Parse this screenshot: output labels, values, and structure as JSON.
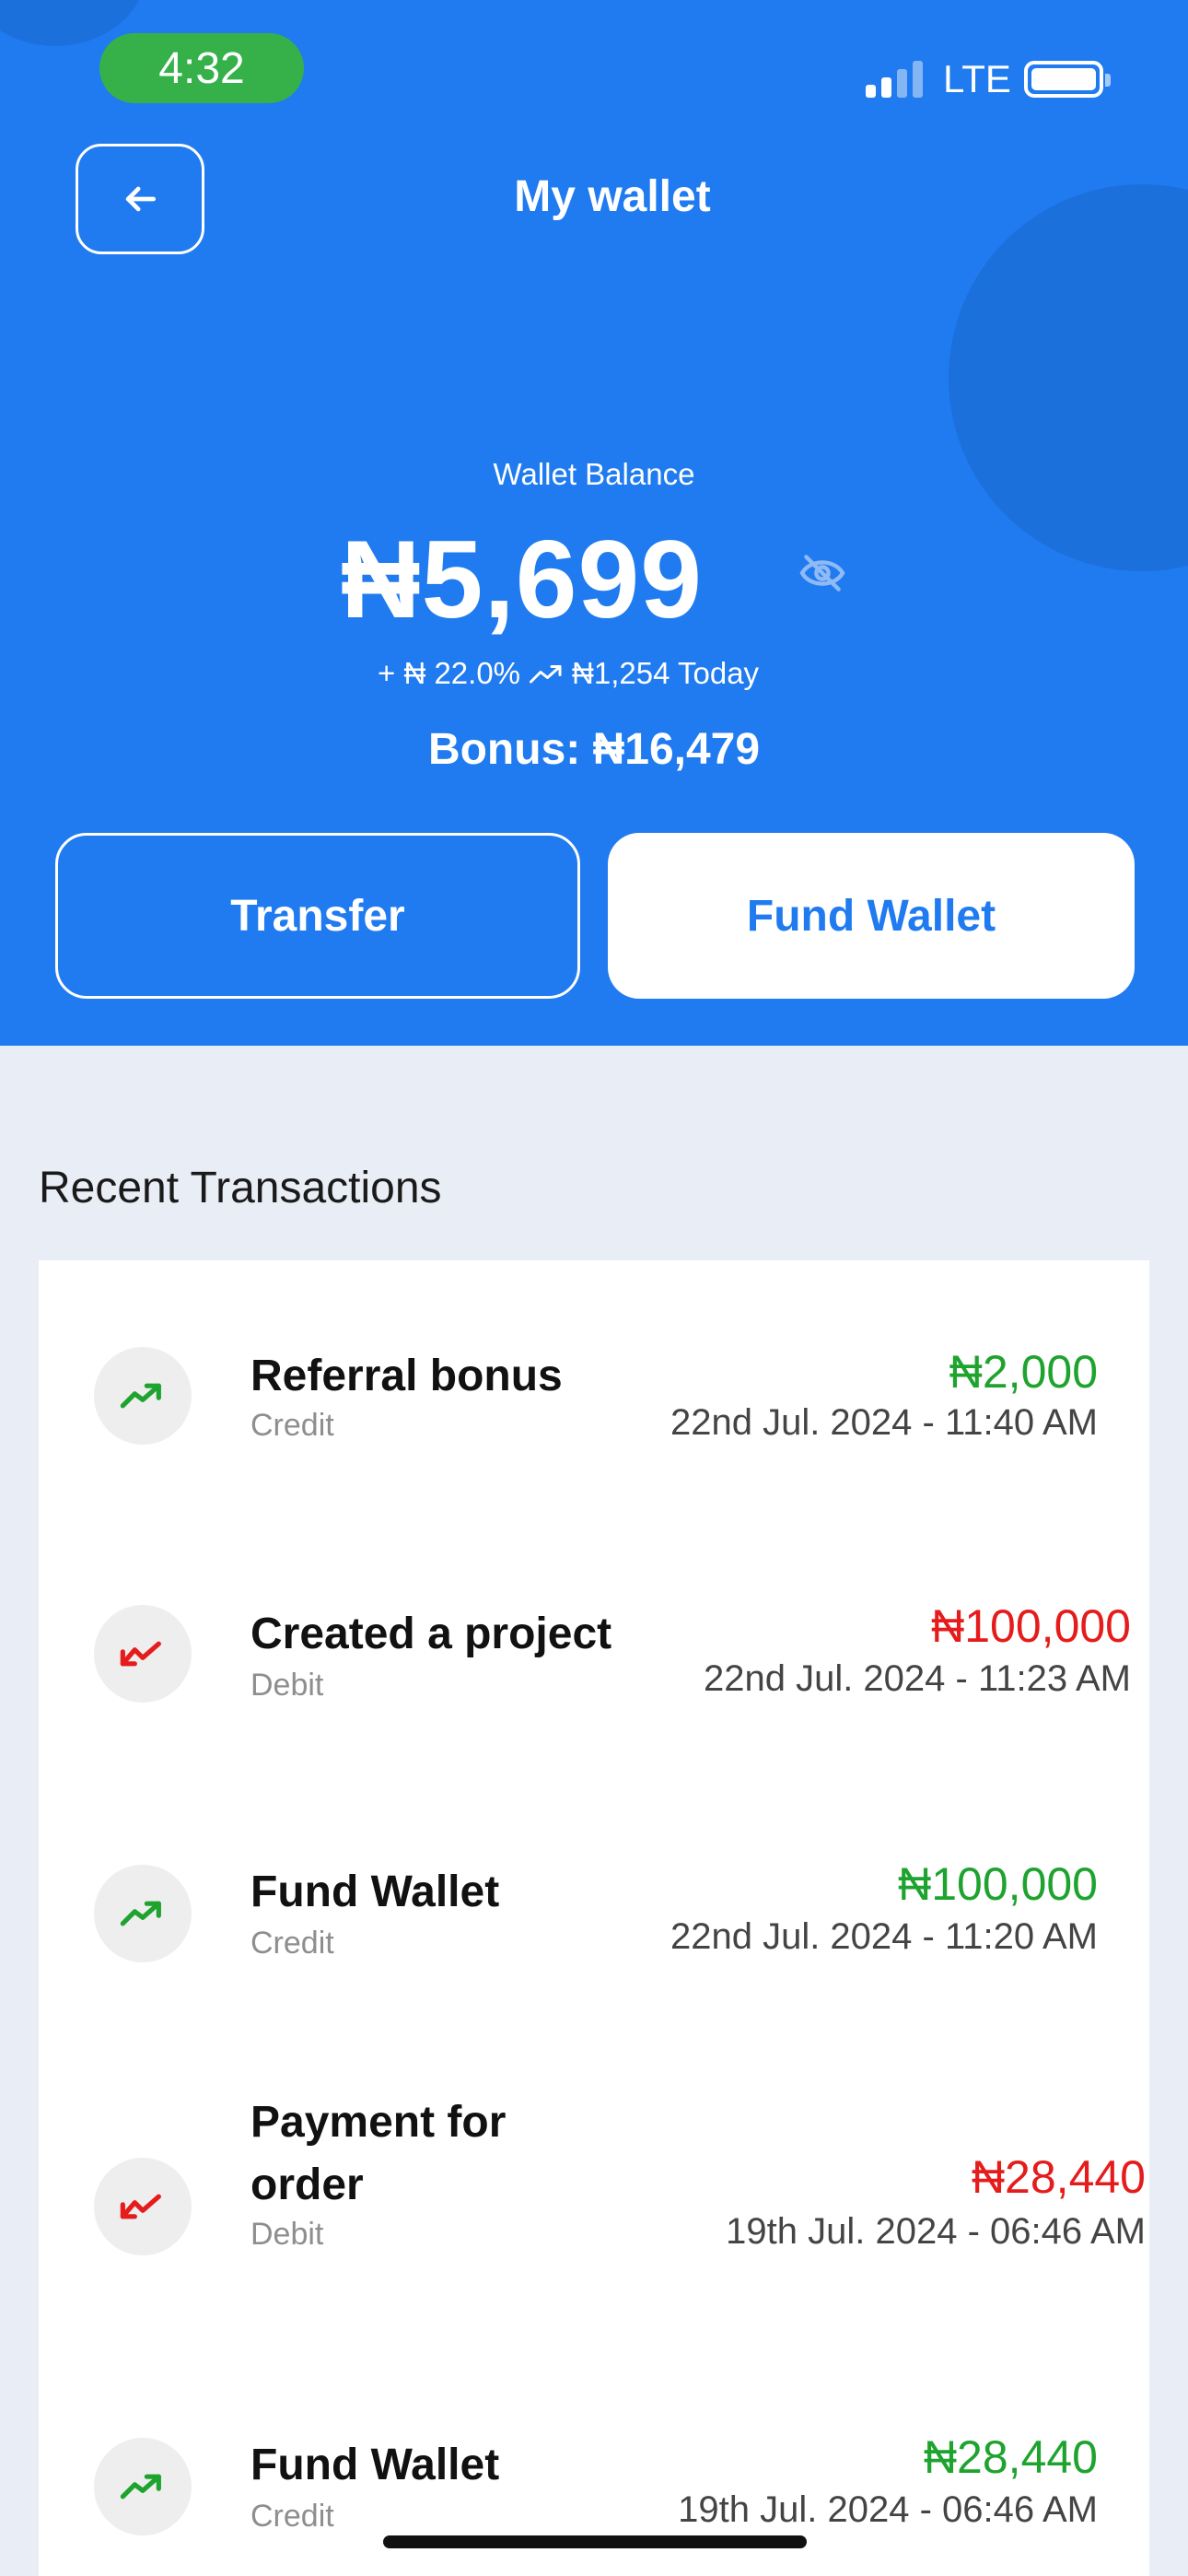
{
  "status_bar": {
    "time": "4:32",
    "network": "LTE"
  },
  "header": {
    "title": "My wallet"
  },
  "wallet": {
    "balance_label": "Wallet Balance",
    "balance": "₦5,699",
    "change_percent": "+ ₦ 22.0%",
    "change_today": "₦1,254 Today",
    "bonus": "Bonus: ₦16,479"
  },
  "actions": {
    "transfer_label": "Transfer",
    "fund_label": "Fund Wallet"
  },
  "transactions_title": "Recent Transactions",
  "transactions": [
    {
      "title": "Referral bonus",
      "type": "Credit",
      "amount": "₦2,000",
      "date": "22nd Jul. 2024 - 11:40 AM"
    },
    {
      "title": "Created a project",
      "type": "Debit",
      "amount": "₦100,000",
      "date": "22nd Jul. 2024 - 11:23 AM"
    },
    {
      "title": "Fund Wallet",
      "type": "Credit",
      "amount": "₦100,000",
      "date": "22nd Jul. 2024 - 11:20 AM"
    },
    {
      "title": "Payment for order",
      "type": "Debit",
      "amount": "₦28,440",
      "date": "19th Jul. 2024 - 06:46 AM"
    },
    {
      "title": "Fund Wallet",
      "type": "Credit",
      "amount": "₦28,440",
      "date": "19th Jul. 2024 - 06:46 AM"
    }
  ],
  "colors": {
    "primary": "#1f7bef",
    "credit": "#1fa32f",
    "debit": "#e51c1c",
    "time_pill": "#36b14a"
  },
  "icons": {
    "credit": "trending-up-icon",
    "debit": "trending-down-icon",
    "back": "arrow-left-icon",
    "hide": "eye-off-icon"
  }
}
